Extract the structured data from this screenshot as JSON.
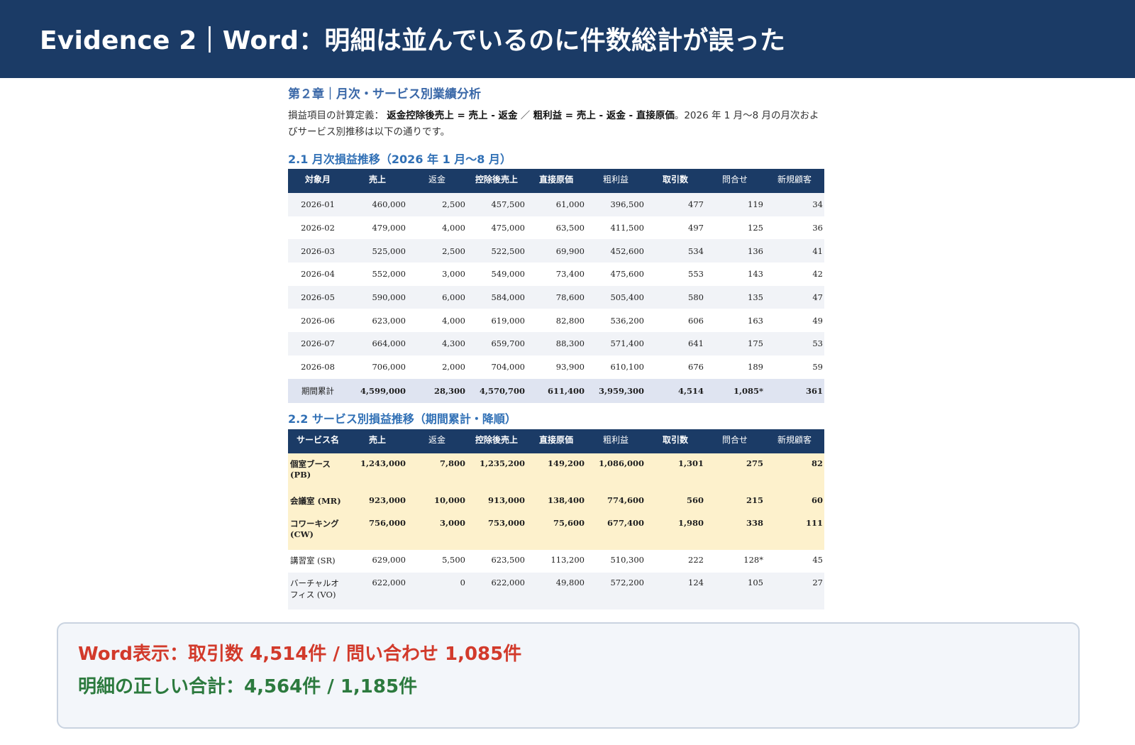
{
  "banner": {
    "title": "Evidence 2｜Word：明細は並んでいるのに件数総計が誤った"
  },
  "doc": {
    "chapter_title": "第２章｜月次・サービス別業績分析",
    "definition": {
      "prefix": "損益項目の計算定義：",
      "term1": "返金控除後売上 = 売上 - 返金",
      "sep": " ／ ",
      "term2": "粗利益 = 売上 - 返金 - 直接原価",
      "suffix": "。2026 年 1 月〜8 月の月次およびサービス別推移は以下の通りです。"
    },
    "section1_title": "2.1 月次損益推移（2026 年 1 月〜8 月）",
    "section2_title": "2.2 サービス別損益推移（期間累計・降順）",
    "monthly_table": {
      "headers": [
        "対象月",
        "売上",
        "返金",
        "控除後売上",
        "直接原価",
        "粗利益",
        "取引数",
        "問合せ",
        "新規顧客"
      ],
      "rows": [
        [
          "2026-01",
          "460,000",
          "2,500",
          "457,500",
          "61,000",
          "396,500",
          "477",
          "119",
          "34"
        ],
        [
          "2026-02",
          "479,000",
          "4,000",
          "475,000",
          "63,500",
          "411,500",
          "497",
          "125",
          "36"
        ],
        [
          "2026-03",
          "525,000",
          "2,500",
          "522,500",
          "69,900",
          "452,600",
          "534",
          "136",
          "41"
        ],
        [
          "2026-04",
          "552,000",
          "3,000",
          "549,000",
          "73,400",
          "475,600",
          "553",
          "143",
          "42"
        ],
        [
          "2026-05",
          "590,000",
          "6,000",
          "584,000",
          "78,600",
          "505,400",
          "580",
          "135",
          "47"
        ],
        [
          "2026-06",
          "623,000",
          "4,000",
          "619,000",
          "82,800",
          "536,200",
          "606",
          "163",
          "49"
        ],
        [
          "2026-07",
          "664,000",
          "4,300",
          "659,700",
          "88,300",
          "571,400",
          "641",
          "175",
          "53"
        ],
        [
          "2026-08",
          "706,000",
          "2,000",
          "704,000",
          "93,900",
          "610,100",
          "676",
          "189",
          "59"
        ]
      ],
      "total": [
        "期間累計",
        "4,599,000",
        "28,300",
        "4,570,700",
        "611,400",
        "3,959,300",
        "4,514",
        "1,085*",
        "361"
      ]
    },
    "service_table": {
      "headers": [
        "サービス名",
        "売上",
        "返金",
        "控除後売上",
        "直接原価",
        "粗利益",
        "取引数",
        "問合せ",
        "新規顧客"
      ],
      "rows": [
        [
          "個室ブース (PB)",
          "1,243,000",
          "7,800",
          "1,235,200",
          "149,200",
          "1,086,000",
          "1,301",
          "275",
          "82"
        ],
        [
          "会議室 (MR)",
          "923,000",
          "10,000",
          "913,000",
          "138,400",
          "774,600",
          "560",
          "215",
          "60"
        ],
        [
          "コワーキング (CW)",
          "756,000",
          "3,000",
          "753,000",
          "75,600",
          "677,400",
          "1,980",
          "338",
          "111"
        ],
        [
          "講習室 (SR)",
          "629,000",
          "5,500",
          "623,500",
          "113,200",
          "510,300",
          "222",
          "128*",
          "45"
        ],
        [
          "バーチャルオフィス (VO)",
          "622,000",
          "0",
          "622,000",
          "49,800",
          "572,200",
          "124",
          "105",
          "27"
        ]
      ]
    }
  },
  "callout": {
    "line1": "Word表示：取引数 4,514件 / 問い合わせ 1,085件",
    "line2": "明細の正しい合計：4,564件 / 1,185件"
  },
  "colors": {
    "banner": "#1b3b66",
    "error": "#d23a2b",
    "correct": "#2c7a3e",
    "highlight_row": "#fdf1cc"
  }
}
